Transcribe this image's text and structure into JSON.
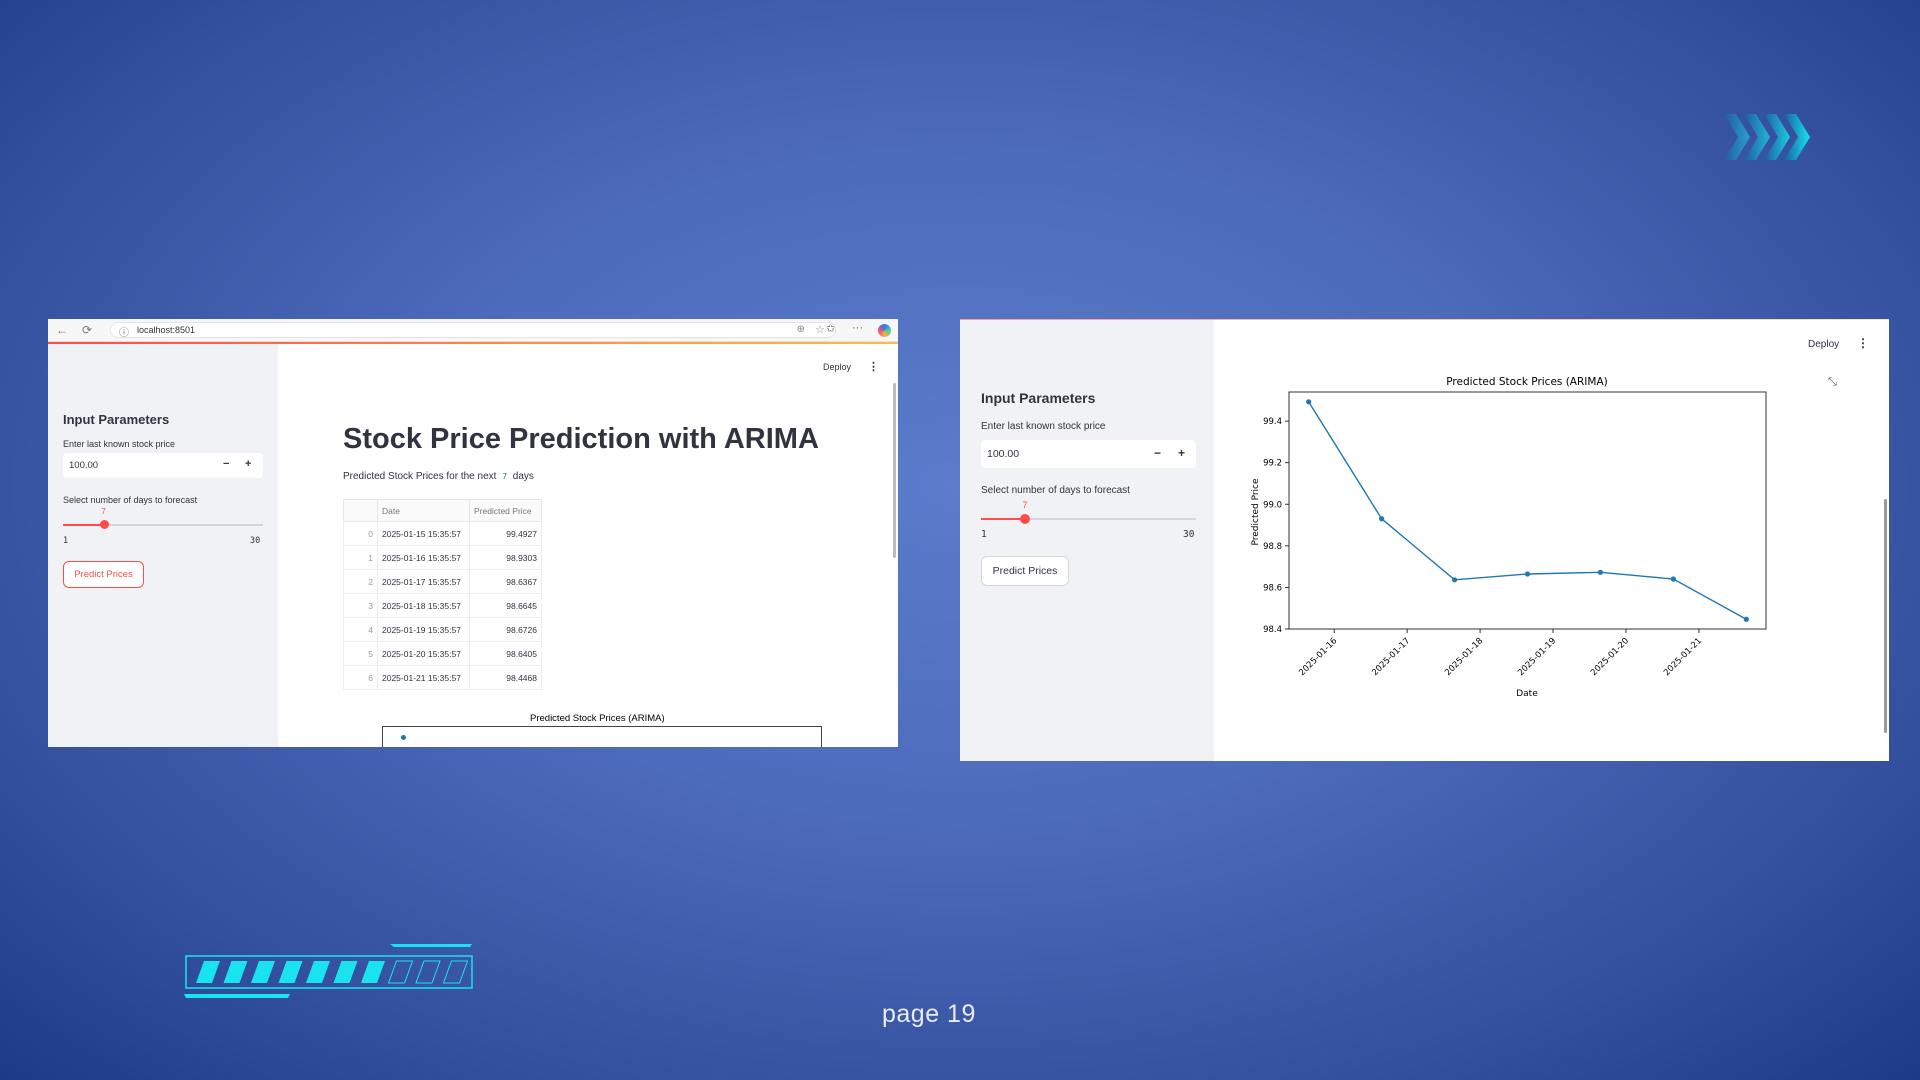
{
  "left_window": {
    "browser": {
      "url": "localhost:8501"
    },
    "sidebar": {
      "title": "Input Parameters",
      "price_label": "Enter last known stock price",
      "price_value": "100.00",
      "days_label": "Select number of days to forecast",
      "slider_value": "7",
      "slider_min": "1",
      "slider_max": "30",
      "slider_fraction": 0.2069,
      "button": "Predict Prices"
    },
    "header": {
      "deploy": "Deploy"
    },
    "main": {
      "title": "Stock Price Prediction with ARIMA",
      "subtitle_pre": "Predicted Stock Prices for the next",
      "subtitle_num": "7",
      "subtitle_post": "days",
      "table": {
        "columns": [
          "",
          "Date",
          "Predicted Price"
        ],
        "rows": [
          [
            "0",
            "2025-01-15 15:35:57",
            "99.4927"
          ],
          [
            "1",
            "2025-01-16 15:35:57",
            "98.9303"
          ],
          [
            "2",
            "2025-01-17 15:35:57",
            "98.6367"
          ],
          [
            "3",
            "2025-01-18 15:35:57",
            "98.6645"
          ],
          [
            "4",
            "2025-01-19 15:35:57",
            "98.6726"
          ],
          [
            "5",
            "2025-01-20 15:35:57",
            "98.6405"
          ],
          [
            "6",
            "2025-01-21 15:35:57",
            "98.4468"
          ]
        ]
      },
      "chart_title": "Predicted Stock Prices (ARIMA)"
    }
  },
  "right_window": {
    "sidebar": {
      "title": "Input Parameters",
      "price_label": "Enter last known stock price",
      "price_value": "100.00",
      "days_label": "Select number of days to forecast",
      "slider_value": "7",
      "slider_min": "1",
      "slider_max": "30",
      "slider_fraction": 0.2069,
      "button": "Predict Prices"
    },
    "header": {
      "deploy": "Deploy"
    }
  },
  "chart_data": {
    "type": "line",
    "title": "Predicted Stock Prices (ARIMA)",
    "xlabel": "Date",
    "ylabel": "Predicted Price",
    "x": [
      "2025-01-15 15:35:57",
      "2025-01-16 15:35:57",
      "2025-01-17 15:35:57",
      "2025-01-18 15:35:57",
      "2025-01-19 15:35:57",
      "2025-01-20 15:35:57",
      "2025-01-21 15:35:57"
    ],
    "values": [
      99.4927,
      98.9303,
      98.6367,
      98.6645,
      98.6726,
      98.6405,
      98.4468
    ],
    "xticks": [
      "2025-01-16",
      "2025-01-17",
      "2025-01-18",
      "2025-01-19",
      "2025-01-20",
      "2025-01-21"
    ],
    "yticks": [
      "98.4",
      "98.6",
      "98.8",
      "99.0",
      "99.2",
      "99.4"
    ],
    "ylim": [
      98.4,
      99.54
    ],
    "grid": false,
    "color": "#1f77b4"
  },
  "slide": {
    "page": "page 19",
    "accent": "#19e3ee"
  }
}
